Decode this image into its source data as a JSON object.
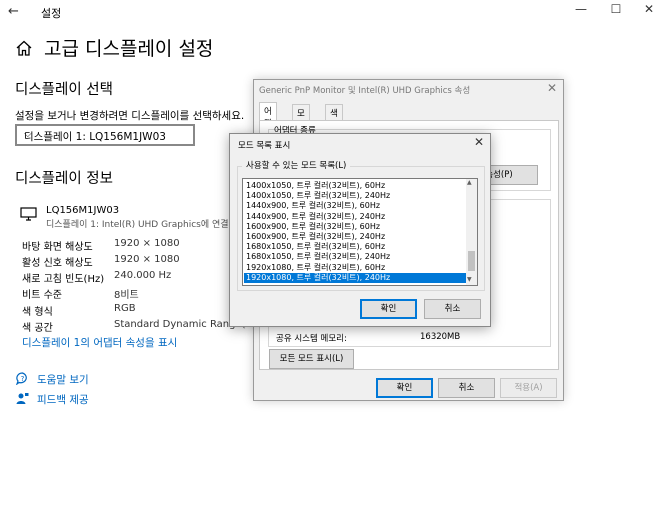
{
  "window": {
    "title": "설정",
    "back_glyph": "←",
    "min_glyph": "—",
    "max_glyph": "☐",
    "close_glyph": "✕"
  },
  "page": {
    "title": "고급 디스플레이 설정"
  },
  "select_section": {
    "heading": "디스플레이 선택",
    "instruction": "설정을 보거나 변경하려면 디스플레이를 선택하세요.",
    "dropdown_value": "디스플레이 1: LQ156M1JW03"
  },
  "info_section": {
    "heading": "디스플레이 정보",
    "monitor_name": "LQ156M1JW03",
    "monitor_sub": "디스플레이 1: Intel(R) UHD Graphics에 연결됨",
    "rows": [
      {
        "key": "바탕 화면 해상도",
        "value": "1920 × 1080"
      },
      {
        "key": "활성 신호 해상도",
        "value": "1920 × 1080"
      },
      {
        "key": "새로 고침 빈도(Hz)",
        "value": "240.000 Hz"
      },
      {
        "key": "비트 수준",
        "value": "8비트"
      },
      {
        "key": "색 형식",
        "value": "RGB"
      },
      {
        "key": "색 공간",
        "value": "Standard Dynamic Range(SDR)"
      }
    ],
    "adapter_link": "디스플레이 1의 어댑터 속성을 표시"
  },
  "help": {
    "get_help": "도움말 보기",
    "feedback": "피드백 제공"
  },
  "adapter_dialog": {
    "title": "Generic PnP Monitor 및 Intel(R) UHD Graphics 속성",
    "tabs": [
      "어댑터",
      "모니터",
      "색 관리"
    ],
    "adapter_type_label": "어댑터 종류",
    "properties_button": "속성(P)",
    "shared_memory_label": "공유 시스템 메모리:",
    "shared_memory_value": "16320MB",
    "list_all_modes_button": "모든 모드 표시(L)",
    "ok": "확인",
    "cancel": "취소",
    "apply": "적용(A)"
  },
  "modes_dialog": {
    "title": "모드 목록 표시",
    "list_label": "사용할 수 있는 모드 목록(L)",
    "modes": [
      "1400x1050, 트루 컬러(32비트), 60Hz",
      "1400x1050, 트루 컬러(32비트), 240Hz",
      "1440x900, 트루 컬러(32비트), 60Hz",
      "1440x900, 트루 컬러(32비트), 240Hz",
      "1600x900, 트루 컬러(32비트), 60Hz",
      "1600x900, 트루 컬러(32비트), 240Hz",
      "1680x1050, 트루 컬러(32비트), 60Hz",
      "1680x1050, 트루 컬러(32비트), 240Hz",
      "1920x1080, 트루 컬러(32비트), 60Hz",
      "1920x1080, 트루 컬러(32비트), 240Hz"
    ],
    "selected_index": 9,
    "ok": "확인",
    "cancel": "취소"
  },
  "colors": {
    "accent": "#0078d7",
    "link": "#0067c0"
  }
}
